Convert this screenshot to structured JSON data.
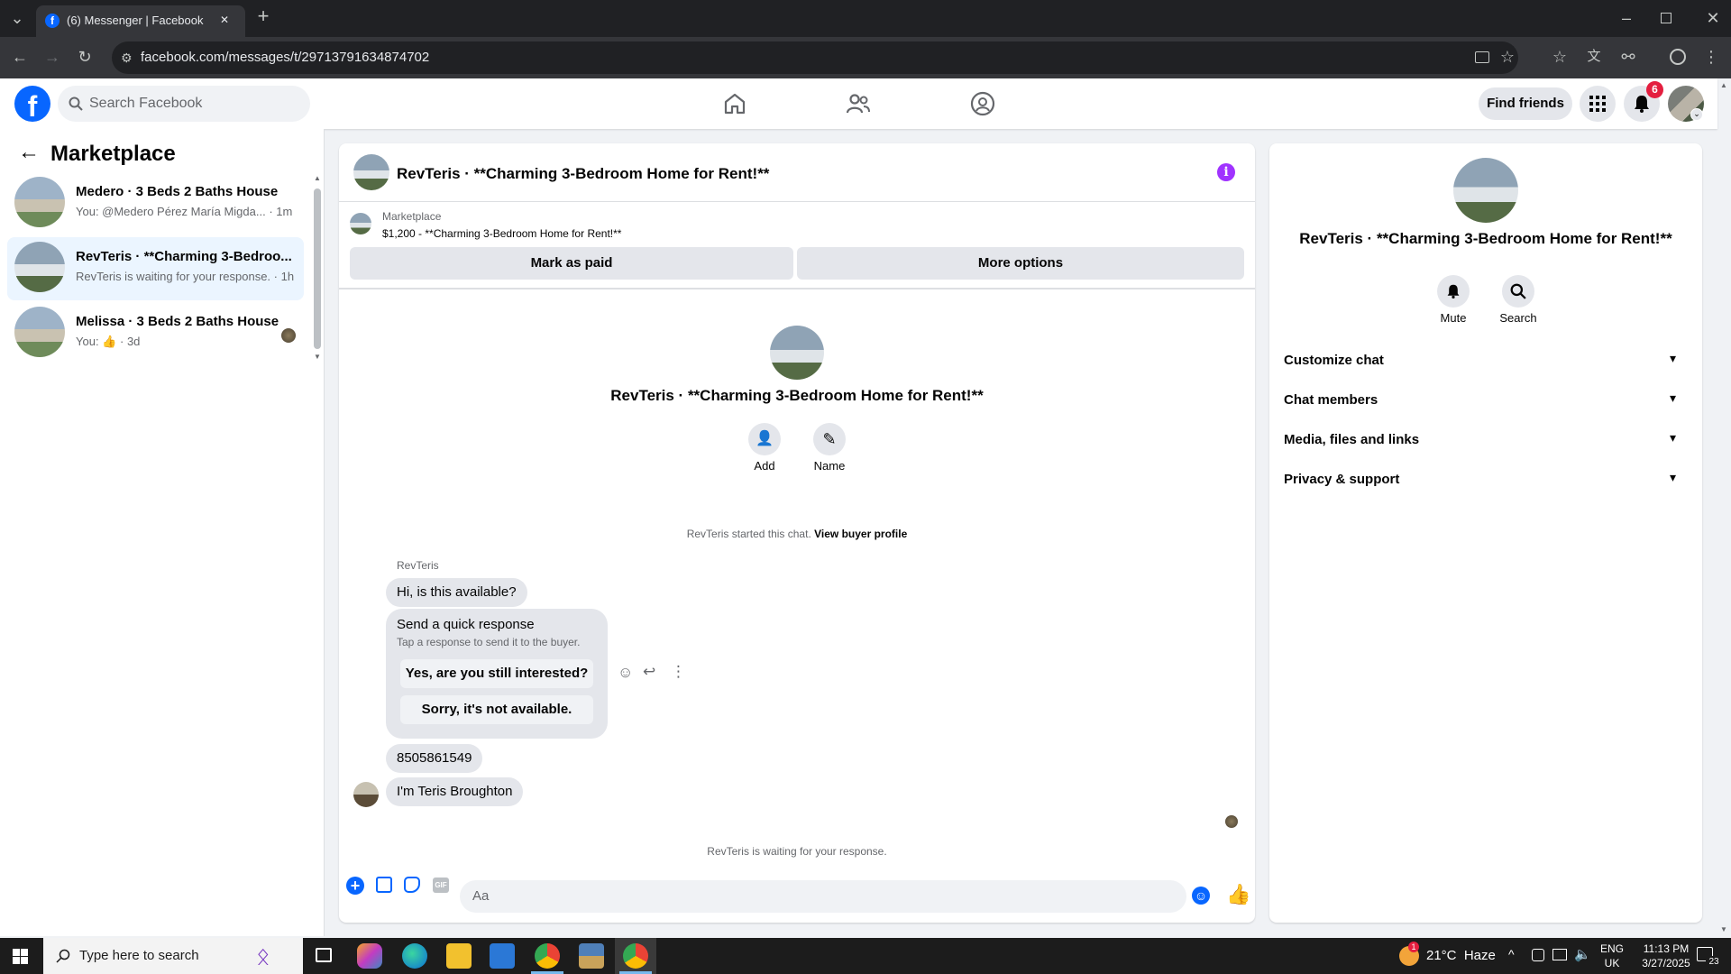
{
  "browser": {
    "tab_title": "(6) Messenger | Facebook",
    "url": "facebook.com/messages/t/29713791634874702",
    "new_tab": "+",
    "close_tab": "✕"
  },
  "header": {
    "search_placeholder": "Search Facebook",
    "find_friends": "Find friends",
    "notification_count": "6"
  },
  "sidebar": {
    "title": "Marketplace",
    "conversations": [
      {
        "title": "Medero · 3 Beds 2 Baths House",
        "subtitle": "You: @Medero Pérez María Migda... · 1m"
      },
      {
        "title": "RevTeris · **Charming 3-Bedroo...",
        "subtitle": "RevTeris is waiting for your response. · 1h"
      },
      {
        "title": "Melissa · 3 Beds 2 Baths House",
        "subtitle_prefix": "You:",
        "subtitle_suffix": "· 3d"
      }
    ]
  },
  "chat": {
    "header_title": "RevTeris · **Charming 3-Bedroom Home for Rent!**",
    "listing_label": "Marketplace",
    "listing_text": "$1,200 - **Charming 3-Bedroom Home for Rent!**",
    "mark_paid": "Mark as paid",
    "more_options": "More options",
    "profile_name": "RevTeris · **Charming 3-Bedroom Home for Rent!**",
    "add_label": "Add",
    "name_label": "Name",
    "started_text": "RevTeris started this chat.",
    "view_profile": "View buyer profile",
    "sender_name": "RevTeris",
    "msg1": "Hi, is this available?",
    "quick_title": "Send a quick response",
    "quick_sub": "Tap a response to send it to the buyer.",
    "quick_yes": "Yes, are you still interested?",
    "quick_no": "Sorry, it's not available.",
    "msg2": "8505861549",
    "msg3": "I'm Teris Broughton",
    "waiting_text": "RevTeris is waiting for your response.",
    "composer_placeholder": "Aa"
  },
  "details": {
    "name": "RevTeris · **Charming 3-Bedroom Home for Rent!**",
    "mute": "Mute",
    "search": "Search",
    "sections": [
      "Customize chat",
      "Chat members",
      "Media, files and links",
      "Privacy & support"
    ]
  },
  "taskbar": {
    "search_placeholder": "Type here to search",
    "weather": "21°C  Haze",
    "lang1": "ENG",
    "lang2": "UK",
    "time": "11:13 PM",
    "date": "3/27/2025",
    "notif_count": "23",
    "weather_badge": "1"
  },
  "colors": {
    "fb_blue": "#0866ff",
    "active_bg": "#ebf5ff",
    "badge_red": "#e41e3f",
    "info_purple": "#a033ff"
  }
}
